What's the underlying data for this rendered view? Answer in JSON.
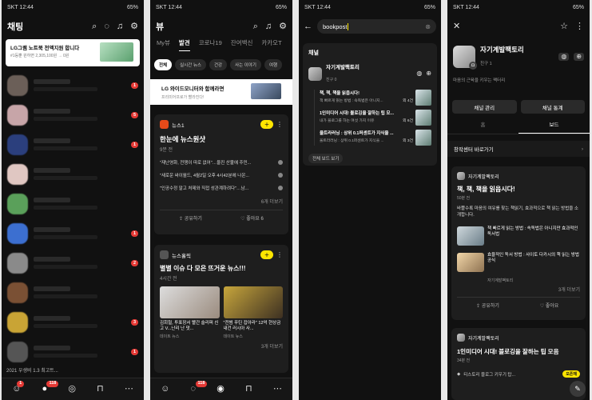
{
  "status": {
    "p1": "SKT 12:44",
    "p2": "SKT 12:44",
    "p3": "SKT 12:44",
    "p4": "SKT 12:44",
    "battery": "65%"
  },
  "chat": {
    "title": "채팅",
    "ad": {
      "title": "LG그램 노트북 전액지원 합니다",
      "sub": "#1등뿐 원하면 2,305,100원 → 0원"
    },
    "last_item": "2021 우생비 1.3 최고트...",
    "rows": [
      {
        "badge": "1"
      },
      {
        "badge": "5"
      },
      {
        "badge": "1"
      },
      {
        "badge": ""
      },
      {
        "badge": ""
      },
      {
        "badge": "1"
      },
      {
        "badge": "2"
      },
      {
        "badge": ""
      },
      {
        "badge": "3"
      },
      {
        "badge": "1"
      }
    ]
  },
  "nav": {
    "badge1": "1",
    "badge2": "118",
    "badge3": "118"
  },
  "view": {
    "title": "뷰",
    "tabs": [
      "My뷰",
      "발견",
      "코로나19",
      "잔여백신",
      "카카오T"
    ],
    "chips": [
      "전체",
      "실시간 뉴스",
      "건강",
      "사는 이야기",
      "여행"
    ],
    "ad": {
      "title": "LG 와이드모니터와 함께라면",
      "sub": "프리미어프로가 빨라진다!"
    },
    "c1": {
      "src": "뉴스1",
      "title": "한눈에 뉴스원샷",
      "time": "9분 전",
      "items": [
        "\"재난영화, 전쟁이 따로 없어\"…울진 산불에 주민...",
        "\"새로운 싸이월드, 4월2일 오후 4시42분에 나온...",
        "\"인공수정 말고 처제와 직접 성관계하려다\"…남..."
      ],
      "more": "6개 더보기",
      "share": "공유하기",
      "like": "좋아요 6"
    },
    "c2": {
      "src": "뉴스홀릭",
      "title": "별별 이슈 다 모은 뜨거운 뉴스!!!",
      "time": "4시간 전",
      "a": "김회철, 투표장서 빨간 슬리퍼 신고 V...난리 난 댓...",
      "b": "\"전범 푸틴 잡아라\" 12억 현상금 내건 러시아 사...",
      "la": "데이트 뉴스",
      "lb": "데이트 뉴스",
      "more": "3개 더보기"
    }
  },
  "search": {
    "query": "bookpost",
    "section": "채널",
    "ch": {
      "name": "자기계발팩토리",
      "sub": "친구 0"
    },
    "posts": [
      {
        "t": "책, 책, 책을 읽읍시다!",
        "s": "책 빠르게 읽는 방법 : 속독법은 아니지...",
        "n": "외 4건"
      },
      {
        "t": "1인미디어 시대! 블로깅을 잘하는 팁 모...",
        "s": "내가 블로그를 하는 여섯 가지 이유",
        "n": "외 6건"
      },
      {
        "t": "울트라러닝 : 상위 0.1퍼센트가 지식을 ...",
        "s": "울트라러닝 : 상위 0.1퍼센트가 지식을 ...",
        "n": "외 3건"
      }
    ],
    "more": "전체 보드 보기"
  },
  "profile": {
    "name": "자기계발팩토리",
    "sub": "친구 1",
    "desc": "마음의 근육을 키우는 팩터리",
    "btn1": "채널 관리",
    "btn2": "채널 통계",
    "tab1": "홈",
    "tab2": "보드",
    "creator": "창작센터 바로가기",
    "b1": {
      "ch": "자기계발팩토리",
      "title": "책, 책, 책을 읽읍시다!",
      "time": "50분 전",
      "desc": "바쁠수록 마음의 여유를 찾는 책읽기, 효과적으로 책 읽는 방법을 소개합니다.",
      "i1": "책 빠르게 읽는 방법 : 속독법은 아니지만 효과적인 독서법",
      "i2": "효율적인 독서 방법 : 사이토 다카시의 책 읽는 방법 공식",
      "src": "자기계발팩토리",
      "more": "3개 더보기",
      "share": "공유하기",
      "like": "좋아요"
    },
    "b2": {
      "ch": "자기계발팩토리",
      "title": "1인미디어 시대! 블로깅을 잘하는 팁 모음",
      "time": "34분 전",
      "foot": "티스토리 블로그 키우기 탑...",
      "badge": "오픈채"
    }
  },
  "colors": {
    "yellow": "#fee500",
    "red": "#e53935"
  }
}
